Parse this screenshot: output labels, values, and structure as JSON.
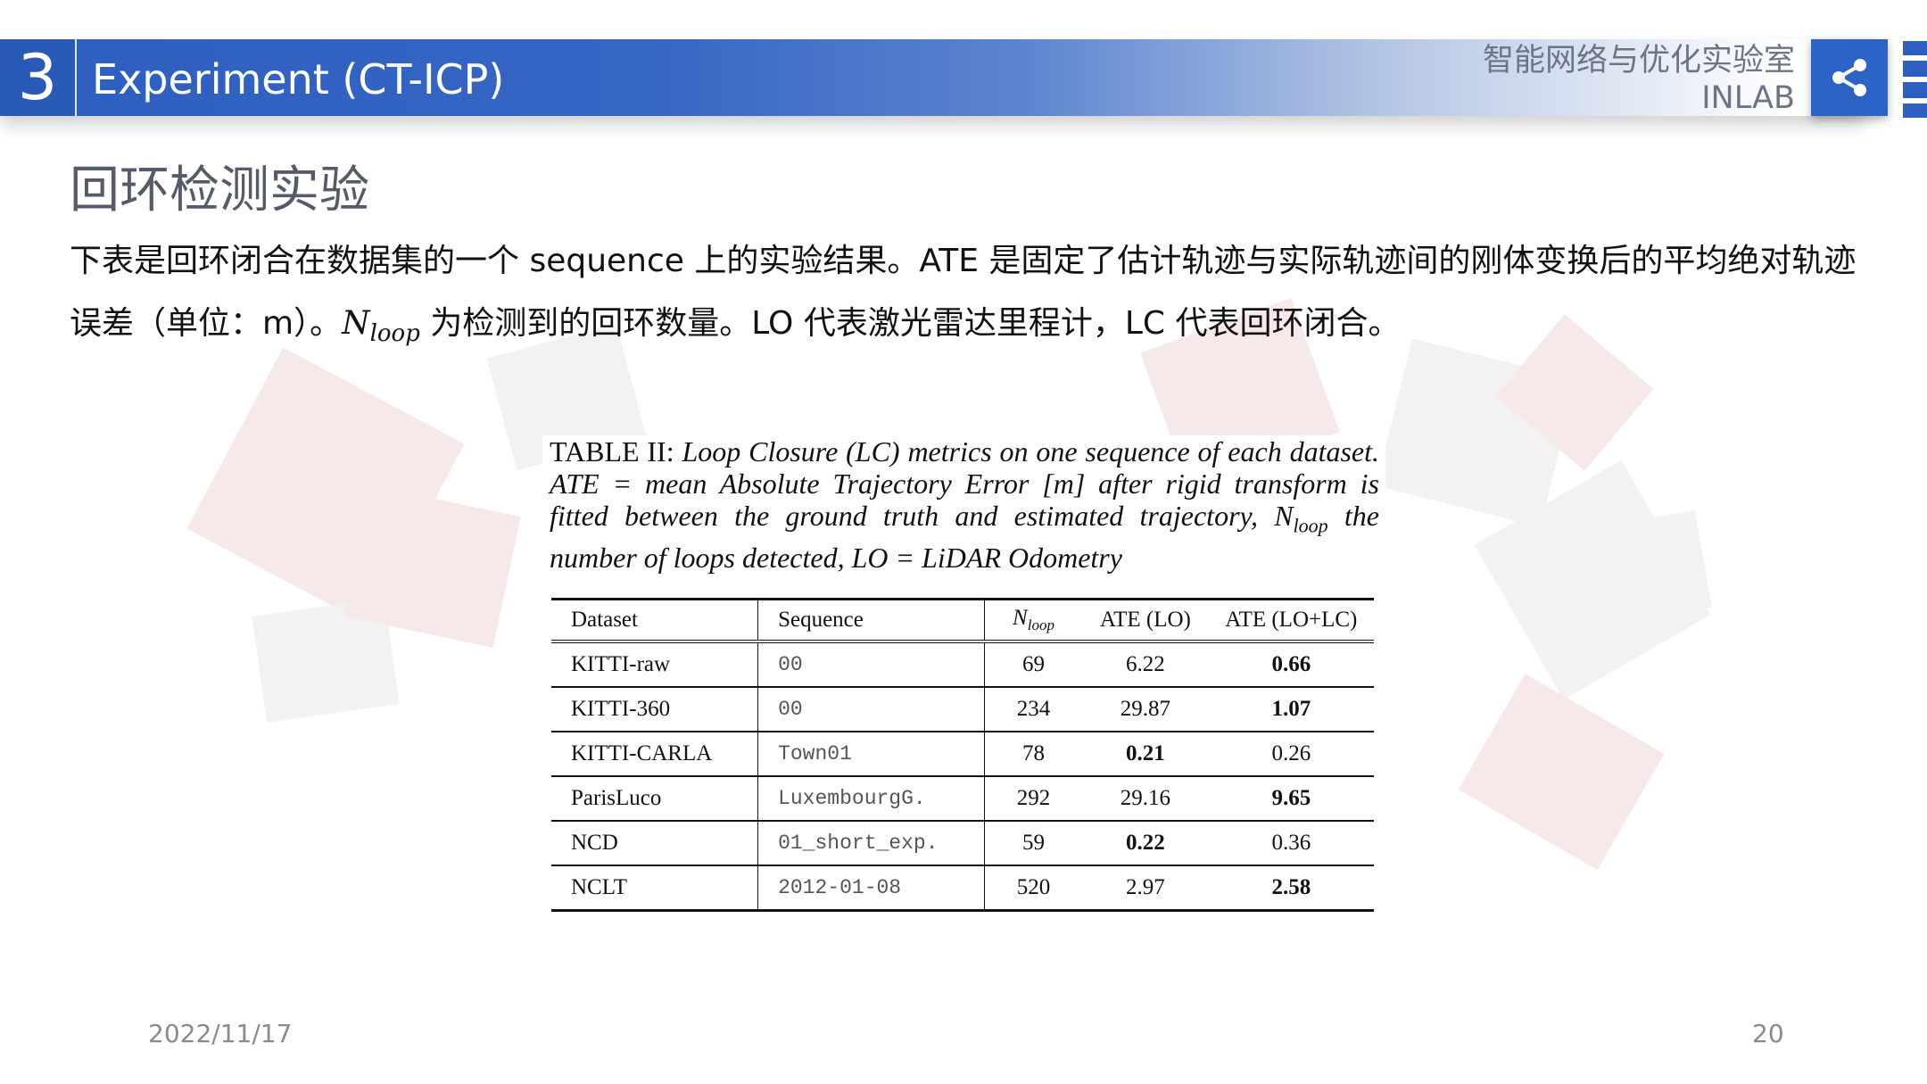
{
  "header": {
    "section_number": "3",
    "title": "Experiment (CT-ICP)",
    "lab_name": "智能网络与优化实验室",
    "lab_abbrev": "INLAB",
    "share_icon": "share-icon"
  },
  "slide": {
    "heading": "回环检测实验",
    "desc_line1": "下表是回环闭合在数据集的一个 sequence 上的实验结果。ATE 是固定了估计轨迹与实际轨迹间的刚体变换后的平均绝对轨迹",
    "desc_line2_a": "误差（单位：m）。",
    "desc_nloop_N": "N",
    "desc_nloop_sub": "loop",
    "desc_line2_b": " 为检测到的回环数量。LO 代表激光雷达里程计，LC 代表回环闭合。"
  },
  "figure": {
    "caption_label": "TABLE II:",
    "caption_part1": "Loop Closure (LC) metrics on one sequence of each dataset. ATE = mean Absolute Trajectory Error [m] after rigid transform is fitted between the ground truth and estimated trajectory, N",
    "caption_sub": "loop",
    "caption_part2": " the number of loops detected, LO = LiDAR Odometry",
    "columns": {
      "dataset": "Dataset",
      "sequence": "Sequence",
      "nloop_N": "N",
      "nloop_sub": "loop",
      "ate_lo": "ATE (LO)",
      "ate_lolc": "ATE (LO+LC)"
    },
    "rows": [
      {
        "dataset": "KITTI-raw",
        "sequence": "00",
        "nloop": "69",
        "ate_lo": "6.22",
        "ate_lolc": "0.66"
      },
      {
        "dataset": "KITTI-360",
        "sequence": "00",
        "nloop": "234",
        "ate_lo": "29.87",
        "ate_lolc": "1.07"
      },
      {
        "dataset": "KITTI-CARLA",
        "sequence": "Town01",
        "nloop": "78",
        "ate_lo": "0.21",
        "ate_lolc": "0.26"
      },
      {
        "dataset": "ParisLuco",
        "sequence": "LuxembourgG.",
        "nloop": "292",
        "ate_lo": "29.16",
        "ate_lolc": "9.65"
      },
      {
        "dataset": "NCD",
        "sequence": "01_short_exp.",
        "nloop": "59",
        "ate_lo": "0.22",
        "ate_lolc": "0.36"
      },
      {
        "dataset": "NCLT",
        "sequence": "2012-01-08",
        "nloop": "520",
        "ate_lo": "2.97",
        "ate_lolc": "2.58"
      }
    ]
  },
  "footer": {
    "date": "2022/11/17",
    "page": "20"
  },
  "colors": {
    "header_blue": "#2d5fc0",
    "text_gray": "#6c7486"
  }
}
